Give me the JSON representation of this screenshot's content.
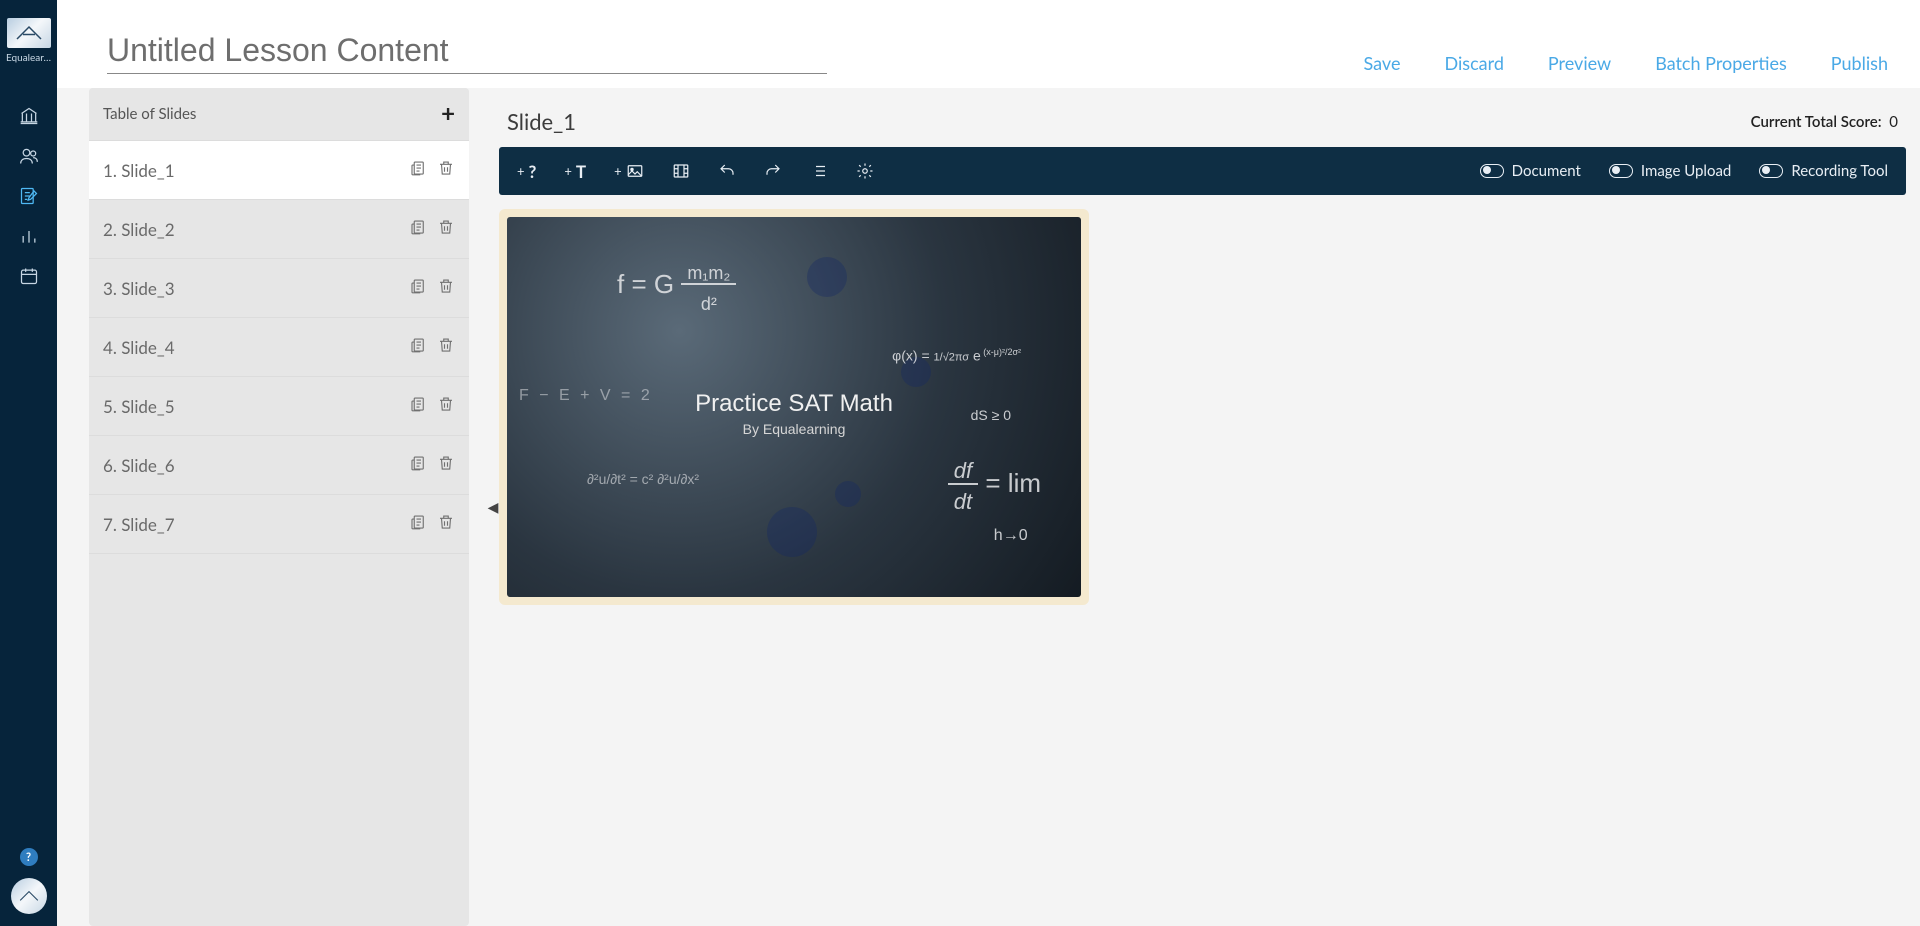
{
  "sidebar": {
    "brand": "Equalear…",
    "help": "?",
    "nav": [
      {
        "name": "institution",
        "active": false
      },
      {
        "name": "people",
        "active": false
      },
      {
        "name": "edit-content",
        "active": true
      },
      {
        "name": "analytics",
        "active": false
      },
      {
        "name": "calendar",
        "active": false
      }
    ]
  },
  "header": {
    "title_value": "Untitled Lesson Content",
    "actions": {
      "save": "Save",
      "discard": "Discard",
      "preview": "Preview",
      "batch_properties": "Batch Properties",
      "publish": "Publish"
    }
  },
  "slides_panel": {
    "title": "Table of Slides",
    "items": [
      {
        "index": "1.",
        "label": "Slide_1",
        "active": true
      },
      {
        "index": "2.",
        "label": "Slide_2",
        "active": false
      },
      {
        "index": "3.",
        "label": "Slide_3",
        "active": false
      },
      {
        "index": "4.",
        "label": "Slide_4",
        "active": false
      },
      {
        "index": "5.",
        "label": "Slide_5",
        "active": false
      },
      {
        "index": "6.",
        "label": "Slide_6",
        "active": false
      },
      {
        "index": "7.",
        "label": "Slide_7",
        "active": false
      }
    ]
  },
  "editor": {
    "slide_name": "Slide_1",
    "score_label": "Current Total Score:",
    "score_value": "0",
    "toolbar": {
      "document": "Document",
      "image_upload": "Image Upload",
      "recording_tool": "Recording Tool"
    },
    "slide_content": {
      "title": "Practice SAT Math",
      "subtitle": "By Equalearning"
    }
  }
}
